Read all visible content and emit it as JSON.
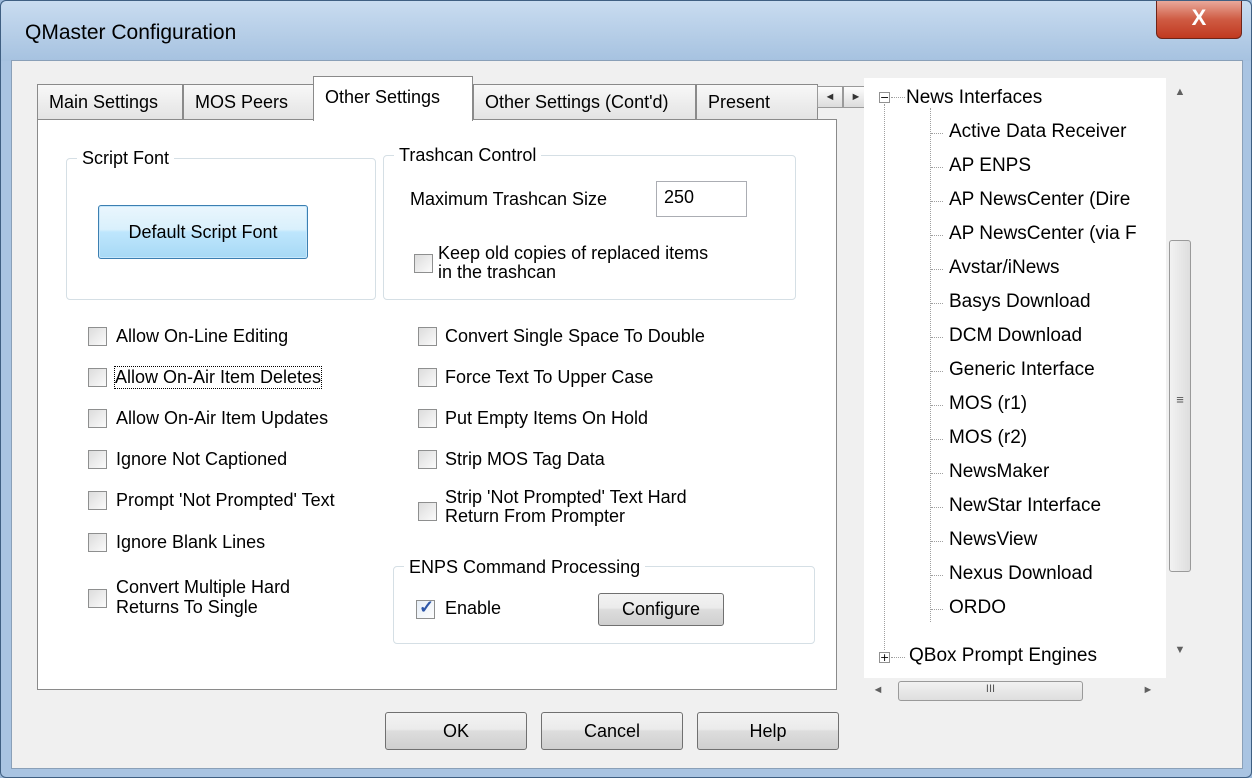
{
  "window": {
    "title": "QMaster Configuration",
    "close_glyph": "X"
  },
  "tabs": [
    {
      "label": "Main Settings",
      "active": false
    },
    {
      "label": "MOS Peers",
      "active": false
    },
    {
      "label": "Other Settings",
      "active": true
    },
    {
      "label": "Other Settings (Cont'd)",
      "active": false
    },
    {
      "label": "Present",
      "active": false
    }
  ],
  "tab_scroll": {
    "left": "◄",
    "right": "►"
  },
  "script_font": {
    "title": "Script Font",
    "button": "Default Script Font"
  },
  "trashcan": {
    "title": "Trashcan Control",
    "max_label": "Maximum Trashcan Size",
    "max_value": "250",
    "keep_copies_line1": "Keep old copies of replaced items",
    "keep_copies_line2": "in the trashcan",
    "keep_copies_checked": false
  },
  "left_options": [
    {
      "label": "Allow On-Line Editing",
      "checked": false
    },
    {
      "label": "Allow On-Air Item Deletes",
      "checked": false,
      "focused": true
    },
    {
      "label": "Allow On-Air Item Updates",
      "checked": false
    },
    {
      "label": "Ignore Not Captioned",
      "checked": false
    },
    {
      "label": "Prompt 'Not Prompted' Text",
      "checked": false
    },
    {
      "label": "Ignore Blank Lines",
      "checked": false
    },
    {
      "label_line1": "Convert Multiple Hard",
      "label_line2": "Returns To Single",
      "checked": false
    }
  ],
  "right_options": [
    {
      "label": "Convert Single Space To Double",
      "checked": false
    },
    {
      "label": "Force Text To Upper Case",
      "checked": false
    },
    {
      "label": "Put Empty Items On Hold",
      "checked": false
    },
    {
      "label": "Strip MOS Tag Data",
      "checked": false
    },
    {
      "label_line1": "Strip 'Not Prompted' Text Hard",
      "label_line2": "Return From Prompter",
      "checked": false
    }
  ],
  "enps": {
    "title": "ENPS Command Processing",
    "enable_label": "Enable",
    "enable_checked": true,
    "check_glyph": "✓",
    "configure": "Configure"
  },
  "buttons": {
    "ok": "OK",
    "cancel": "Cancel",
    "help": "Help"
  },
  "tree": {
    "root": {
      "label": "News Interfaces",
      "toggle": "−"
    },
    "children": [
      "Active Data Receiver",
      "AP ENPS",
      "AP NewsCenter (Dire",
      "AP NewsCenter (via F",
      "Avstar/iNews",
      "Basys Download",
      "DCM Download",
      "Generic Interface",
      "MOS (r1)",
      "MOS (r2)",
      "NewsMaker",
      "NewStar Interface",
      "NewsView",
      "Nexus Download",
      "ORDO"
    ],
    "next": {
      "label": "QBox Prompt Engines",
      "toggle": "+"
    }
  },
  "scrollbar_glyphs": {
    "up": "▲",
    "down": "▼",
    "left": "◄",
    "right": "►",
    "vgrip": "≡",
    "hgrip": "III"
  }
}
